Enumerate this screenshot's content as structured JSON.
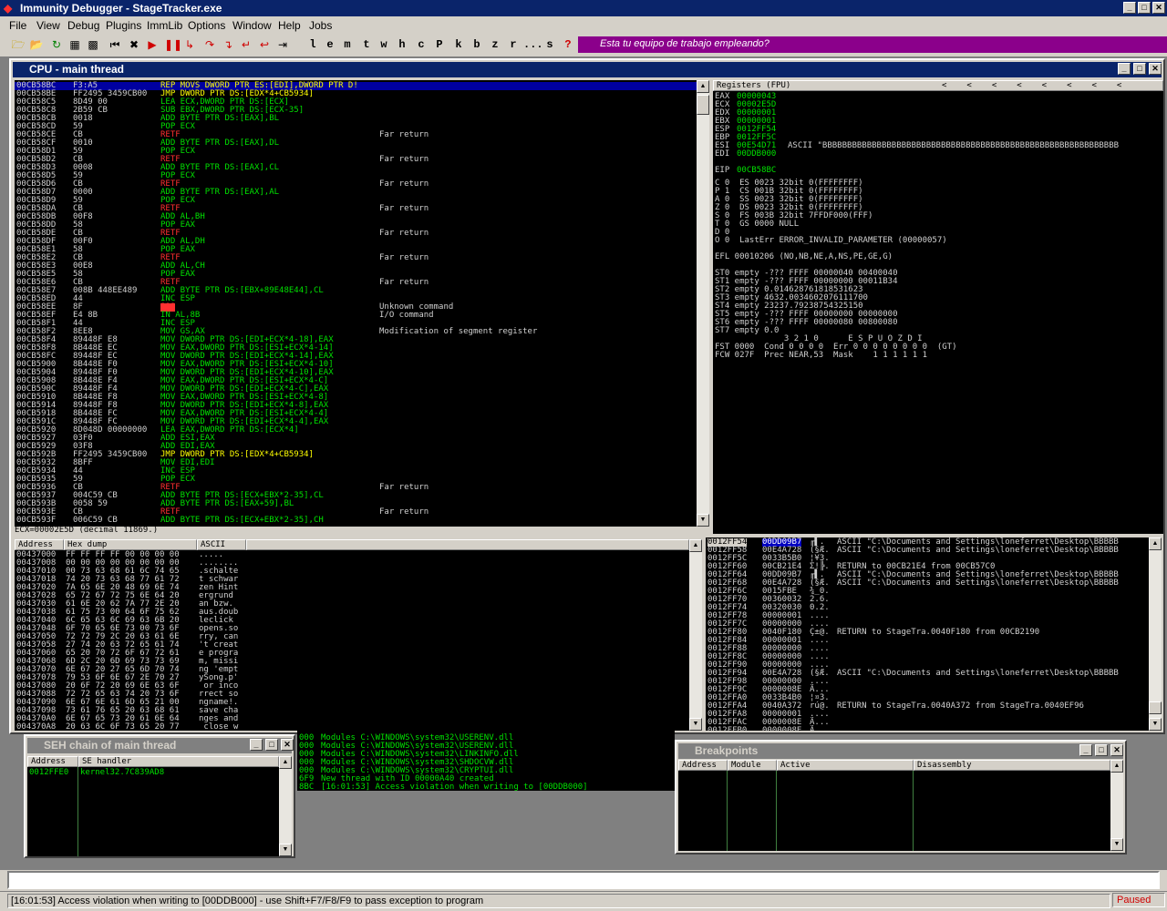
{
  "app": {
    "title": "Immunity Debugger - StageTracker.exe"
  },
  "menu": [
    "File",
    "View",
    "Debug",
    "Plugins",
    "ImmLib",
    "Options",
    "Window",
    "Help",
    "Jobs"
  ],
  "toolbar": {
    "letters": [
      "l",
      "e",
      "m",
      "t",
      "w",
      "h",
      "c",
      "P",
      "k",
      "b",
      "z",
      "r",
      "...",
      "s",
      "?"
    ],
    "banner": "Esta tu equipo de trabajo empleando?"
  },
  "cpu": {
    "title": "CPU - main thread",
    "info_line": "ECX=00002E5D (decimal 11869.)",
    "disasm": [
      [
        "00CB58BC",
        "F3:A5",
        "REP MOVS DWORD PTR ES:[EDI],DWORD PTR D!",
        ""
      ],
      [
        "00CB58BE",
        "FF2495 3459CB00",
        "JMP DWORD PTR DS:[EDX*4+CB5934]",
        ""
      ],
      [
        "00CB58C5",
        "8D49 00",
        "LEA ECX,DWORD PTR DS:[ECX]",
        ""
      ],
      [
        "00CB58C8",
        "2B59 CB",
        "SUB EBX,DWORD PTR DS:[ECX-35]",
        ""
      ],
      [
        "00CB58CB",
        "0018",
        "ADD BYTE PTR DS:[EAX],BL",
        ""
      ],
      [
        "00CB58CD",
        "59",
        "POP ECX",
        ""
      ],
      [
        "00CB58CE",
        "CB",
        "RETF",
        "Far return"
      ],
      [
        "00CB58CF",
        "0010",
        "ADD BYTE PTR DS:[EAX],DL",
        ""
      ],
      [
        "00CB58D1",
        "59",
        "POP ECX",
        ""
      ],
      [
        "00CB58D2",
        "CB",
        "RETF",
        "Far return"
      ],
      [
        "00CB58D3",
        "0008",
        "ADD BYTE PTR DS:[EAX],CL",
        ""
      ],
      [
        "00CB58D5",
        "59",
        "POP ECX",
        ""
      ],
      [
        "00CB58D6",
        "CB",
        "RETF",
        "Far return"
      ],
      [
        "00CB58D7",
        "0000",
        "ADD BYTE PTR DS:[EAX],AL",
        ""
      ],
      [
        "00CB58D9",
        "59",
        "POP ECX",
        ""
      ],
      [
        "00CB58DA",
        "CB",
        "RETF",
        "Far return"
      ],
      [
        "00CB58DB",
        "00F8",
        "ADD AL,BH",
        ""
      ],
      [
        "00CB58DD",
        "58",
        "POP EAX",
        ""
      ],
      [
        "00CB58DE",
        "CB",
        "RETF",
        "Far return"
      ],
      [
        "00CB58DF",
        "00F0",
        "ADD AL,DH",
        ""
      ],
      [
        "00CB58E1",
        "58",
        "POP EAX",
        ""
      ],
      [
        "00CB58E2",
        "CB",
        "RETF",
        "Far return"
      ],
      [
        "00CB58E3",
        "00E8",
        "ADD AL,CH",
        ""
      ],
      [
        "00CB58E5",
        "58",
        "POP EAX",
        ""
      ],
      [
        "00CB58E6",
        "CB",
        "RETF",
        "Far return"
      ],
      [
        "00CB58E7",
        "008B 448EE489",
        "ADD BYTE PTR DS:[EBX+89E48E44],CL",
        ""
      ],
      [
        "00CB58ED",
        "44",
        "INC ESP",
        ""
      ],
      [
        "00CB58EE",
        "8F",
        "???",
        "Unknown command"
      ],
      [
        "00CB58EF",
        "E4 8B",
        "IN AL,8B",
        "I/O command"
      ],
      [
        "00CB58F1",
        "44",
        "INC ESP",
        ""
      ],
      [
        "00CB58F2",
        "8EE8",
        "MOV GS,AX",
        "Modification of segment register"
      ],
      [
        "00CB58F4",
        "89448F E8",
        "MOV DWORD PTR DS:[EDI+ECX*4-18],EAX",
        ""
      ],
      [
        "00CB58F8",
        "8B448E EC",
        "MOV EAX,DWORD PTR DS:[ESI+ECX*4-14]",
        ""
      ],
      [
        "00CB58FC",
        "89448F EC",
        "MOV DWORD PTR DS:[EDI+ECX*4-14],EAX",
        ""
      ],
      [
        "00CB5900",
        "8B448E F0",
        "MOV EAX,DWORD PTR DS:[ESI+ECX*4-10]",
        ""
      ],
      [
        "00CB5904",
        "89448F F0",
        "MOV DWORD PTR DS:[EDI+ECX*4-10],EAX",
        ""
      ],
      [
        "00CB5908",
        "8B448E F4",
        "MOV EAX,DWORD PTR DS:[ESI+ECX*4-C]",
        ""
      ],
      [
        "00CB590C",
        "89448F F4",
        "MOV DWORD PTR DS:[EDI+ECX*4-C],EAX",
        ""
      ],
      [
        "00CB5910",
        "8B448E F8",
        "MOV EAX,DWORD PTR DS:[ESI+ECX*4-8]",
        ""
      ],
      [
        "00CB5914",
        "89448F F8",
        "MOV DWORD PTR DS:[EDI+ECX*4-8],EAX",
        ""
      ],
      [
        "00CB5918",
        "8B448E FC",
        "MOV EAX,DWORD PTR DS:[ESI+ECX*4-4]",
        ""
      ],
      [
        "00CB591C",
        "89448F FC",
        "MOV DWORD PTR DS:[EDI+ECX*4-4],EAX",
        ""
      ],
      [
        "00CB5920",
        "8D048D 00000000",
        "LEA EAX,DWORD PTR DS:[ECX*4]",
        ""
      ],
      [
        "00CB5927",
        "03F0",
        "ADD ESI,EAX",
        ""
      ],
      [
        "00CB5929",
        "03F8",
        "ADD EDI,EAX",
        ""
      ],
      [
        "00CB592B",
        "FF2495 3459CB00",
        "JMP DWORD PTR DS:[EDX*4+CB5934]",
        ""
      ],
      [
        "00CB5932",
        "8BFF",
        "MOV EDI,EDI",
        ""
      ],
      [
        "00CB5934",
        "44",
        "INC ESP",
        ""
      ],
      [
        "00CB5935",
        "59",
        "POP ECX",
        ""
      ],
      [
        "00CB5936",
        "CB",
        "RETF",
        "Far return"
      ],
      [
        "00CB5937",
        "004C59 CB",
        "ADD BYTE PTR DS:[ECX+EBX*2-35],CL",
        ""
      ],
      [
        "00CB593B",
        "0058 59",
        "ADD BYTE PTR DS:[EAX+59],BL",
        ""
      ],
      [
        "00CB593E",
        "CB",
        "RETF",
        "Far return"
      ],
      [
        "00CB593F",
        "006C59 CB",
        "ADD BYTE PTR DS:[ECX+EBX*2-35],CH",
        ""
      ]
    ],
    "registers_title": "Registers (FPU)",
    "registers": [
      [
        "EAX",
        "00000043",
        ""
      ],
      [
        "ECX",
        "00002E5D",
        ""
      ],
      [
        "EDX",
        "00000001",
        ""
      ],
      [
        "EBX",
        "00000001",
        ""
      ],
      [
        "ESP",
        "0012FF54",
        ""
      ],
      [
        "EBP",
        "0012FF5C",
        ""
      ],
      [
        "ESI",
        "00E54D71",
        "ASCII \"BBBBBBBBBBBBBBBBBBBBBBBBBBBBBBBBBBBBBBBBBBBBBBBBBBBBBBBBBBBB"
      ],
      [
        "EDI",
        "00DDB000",
        ""
      ],
      [
        "",
        "",
        " "
      ],
      [
        "EIP",
        "00CB58BC",
        ""
      ]
    ],
    "flags": [
      "C 0  ES 0023 32bit 0(FFFFFFFF)",
      "P 1  CS 001B 32bit 0(FFFFFFFF)",
      "A 0  SS 0023 32bit 0(FFFFFFFF)",
      "Z 0  DS 0023 32bit 0(FFFFFFFF)",
      "S 0  FS 003B 32bit 7FFDF000(FFF)",
      "T 0  GS 0000 NULL",
      "D 0",
      "O 0  LastErr ERROR_INVALID_PARAMETER (00000057)",
      "",
      "EFL 00010206 (NO,NB,NE,A,NS,PE,GE,G)",
      "",
      "ST0 empty -??? FFFF 00000040 00400040",
      "ST1 empty -??? FFFF 00000000 00011B34",
      "ST2 empty 0.0146287618185316​23",
      "ST3 empty 4632.0034602076111700",
      "ST4 empty 23237.79238754325150",
      "ST5 empty -??? FFFF 00000000 00000000",
      "ST6 empty -??? FFFF 00000080 00800080",
      "ST7 empty 0.0",
      "              3 2 1 0      E S P U O Z D I",
      "FST 0000  Cond 0 0 0 0  Err 0 0 0 0 0 0 0 0  (GT)",
      "FCW 027F  Prec NEAR,53  Mask    1 1 1 1 1 1"
    ],
    "dump_headers": [
      "Address",
      "Hex dump",
      "ASCII"
    ],
    "dump": [
      [
        "00437000",
        "FF FF FF FF 00 00 00 00",
        "....."
      ],
      [
        "00437008",
        "00 00 00 00 00 00 00 00",
        "........"
      ],
      [
        "00437010",
        "00 73 63 68 61 6C 74 65",
        ".schalte"
      ],
      [
        "00437018",
        "74 20 73 63 68 77 61 72",
        "t schwar"
      ],
      [
        "00437020",
        "7A 65 6E 20 48 69 6E 74",
        "zen Hint"
      ],
      [
        "00437028",
        "65 72 67 72 75 6E 64 20",
        "ergrund "
      ],
      [
        "00437030",
        "61 6E 20 62 7A 77 2E 20",
        "an bzw. "
      ],
      [
        "00437038",
        "61 75 73 00 64 6F 75 62",
        "aus.doub"
      ],
      [
        "00437040",
        "6C 65 63 6C 69 63 6B 20",
        "leclick "
      ],
      [
        "00437048",
        "6F 70 65 6E 73 00 73 6F",
        "opens.so"
      ],
      [
        "00437050",
        "72 72 79 2C 20 63 61 6E",
        "rry, can"
      ],
      [
        "00437058",
        "27 74 20 63 72 65 61 74",
        "'t creat"
      ],
      [
        "00437060",
        "65 20 70 72 6F 67 72 61",
        "e progra"
      ],
      [
        "00437068",
        "6D 2C 20 6D 69 73 73 69",
        "m, missi"
      ],
      [
        "00437070",
        "6E 67 20 27 65 6D 70 74",
        "ng 'empt"
      ],
      [
        "00437078",
        "79 53 6F 6E 67 2E 70 27",
        "ySong.p'"
      ],
      [
        "00437080",
        "20 6F 72 20 69 6E 63 6F",
        " or inco"
      ],
      [
        "00437088",
        "72 72 65 63 74 20 73 6F",
        "rrect so"
      ],
      [
        "00437090",
        "6E 67 6E 61 6D 65 21 00",
        "ngname!."
      ],
      [
        "00437098",
        "73 61 76 65 20 63 68 61",
        "save cha"
      ],
      [
        "004370A0",
        "6E 67 65 73 20 61 6E 64",
        "nges and"
      ],
      [
        "004370A8",
        "20 63 6C 6F 73 65 20 77",
        " close w"
      ]
    ],
    "stack": [
      [
        "0012FF54",
        "00DD09B7",
        "╓▌.",
        "ASCII \"C:\\Documents and Settings\\loneferret\\Desktop\\BBBBB"
      ],
      [
        "0012FF58",
        "00E4A728",
        "(§Æ.",
        "ASCII \"C:\\Documents and Settings\\loneferret\\Desktop\\BBBBB"
      ],
      [
        "0012FF5C",
        "0033B5B0",
        "¦¥3.",
        ""
      ],
      [
        "0012FF60",
        "00CB21E4",
        "Σ!╠.",
        "RETURN to 00CB21E4 from 00CB57C0"
      ],
      [
        "0012FF64",
        "00DD09B7",
        "╓▌.",
        "ASCII \"C:\\Documents and Settings\\loneferret\\Desktop\\BBBBB"
      ],
      [
        "0012FF68",
        "00E4A728",
        "(§Æ.",
        "ASCII \"C:\\Documents and Settings\\loneferret\\Desktop\\BBBBB"
      ],
      [
        "0012FF6C",
        "0015FBE",
        "¾_0.",
        ""
      ],
      [
        "0012FF70",
        "00360032",
        "2.6.",
        ""
      ],
      [
        "0012FF74",
        "00320030",
        "0.2.",
        ""
      ],
      [
        "0012FF78",
        "00000001",
        "....",
        ""
      ],
      [
        "0012FF7C",
        "00000000",
        "....",
        ""
      ],
      [
        "0012FF80",
        "0040F180",
        "Ç±@.",
        "RETURN to StageTra.0040F180 from 00CB2190"
      ],
      [
        "0012FF84",
        "00000001",
        "....",
        ""
      ],
      [
        "0012FF88",
        "00000000",
        "....",
        ""
      ],
      [
        "0012FF8C",
        "00000000",
        "....",
        ""
      ],
      [
        "0012FF90",
        "00000000",
        "....",
        ""
      ],
      [
        "0012FF94",
        "00E4A728",
        "(§Æ.",
        "ASCII \"C:\\Documents and Settings\\loneferret\\Desktop\\BBBBB"
      ],
      [
        "0012FF98",
        "00000000",
        "....",
        ""
      ],
      [
        "0012FF9C",
        "0000008E",
        "Ä...",
        ""
      ],
      [
        "0012FFA0",
        "0033B4B0",
        "¦¤3.",
        ""
      ],
      [
        "0012FFA4",
        "0040A372",
        "rú@.",
        "RETURN to StageTra.0040A372 from StageTra.0040EF96"
      ],
      [
        "0012FFA8",
        "00000001",
        "....",
        ""
      ],
      [
        "0012FFAC",
        "0000008E",
        "Ä...",
        ""
      ],
      [
        "0012FFB0",
        "0000008E",
        "Ä...",
        ""
      ]
    ]
  },
  "seh": {
    "title": "SEH chain of main thread",
    "headers": [
      "Address",
      "SE handler"
    ],
    "rows": [
      [
        "0012FFE0",
        "kernel32.7C839AD8"
      ]
    ]
  },
  "log": {
    "rows": [
      [
        "000",
        "Modules C:\\WINDOWS\\system32\\USERENV.dll"
      ],
      [
        "000",
        "Modules C:\\WINDOWS\\system32\\USERENV.dll"
      ],
      [
        "000",
        "Modules C:\\WINDOWS\\system32\\LINKINFO.dll"
      ],
      [
        "000",
        "Modules C:\\WINDOWS\\system32\\SHDOCVW.dll"
      ],
      [
        "000",
        "Modules C:\\WINDOWS\\system32\\CRYPTUI.dll"
      ],
      [
        "6F9",
        "New thread with ID 00000A40 created"
      ],
      [
        "8BC",
        "[16:01:53] Access violation when writing to [00DDB000]"
      ]
    ]
  },
  "breakpoints": {
    "title": "Breakpoints",
    "headers": [
      "Address",
      "Module",
      "Active",
      "Disassembly"
    ]
  },
  "status": {
    "message": "[16:01:53] Access violation when writing to [00DDB000] - use Shift+F7/F8/F9 to pass exception to program",
    "state": "Paused"
  }
}
